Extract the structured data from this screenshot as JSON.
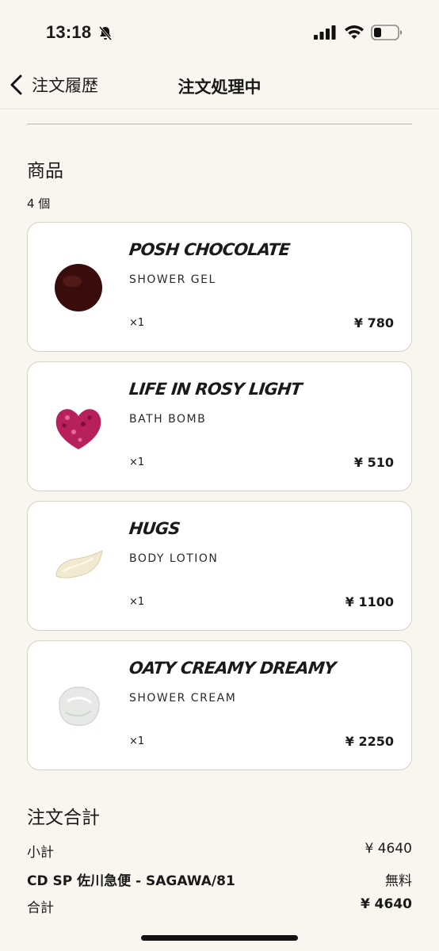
{
  "status": {
    "time": "13:18"
  },
  "nav": {
    "back_label": "注文履歴",
    "title": "注文処理中"
  },
  "products_section": {
    "title": "商品",
    "count": "4 個",
    "items": [
      {
        "name": "POSH CHOCOLATE",
        "type": "SHOWER GEL",
        "qty": "×1",
        "price": "¥ 780",
        "color": "#3b0c0c"
      },
      {
        "name": "LIFE IN ROSY LIGHT",
        "type": "BATH BOMB",
        "qty": "×1",
        "price": "¥ 510",
        "color": "#b7205a"
      },
      {
        "name": "HUGS",
        "type": "BODY LOTION",
        "qty": "×1",
        "price": "¥ 1100",
        "color": "#f2ead0"
      },
      {
        "name": "OATY CREAMY DREAMY",
        "type": "SHOWER CREAM",
        "qty": "×1",
        "price": "¥ 2250",
        "color": "#e6e9e6"
      }
    ]
  },
  "order_total": {
    "title": "注文合計",
    "subtotal_label": "小計",
    "subtotal_value": "¥ 4640",
    "shipping_label": "CD SP 佐川急便 - SAGAWA/81",
    "shipping_value": "無料",
    "total_label": "合計",
    "total_value": "¥ 4640"
  }
}
